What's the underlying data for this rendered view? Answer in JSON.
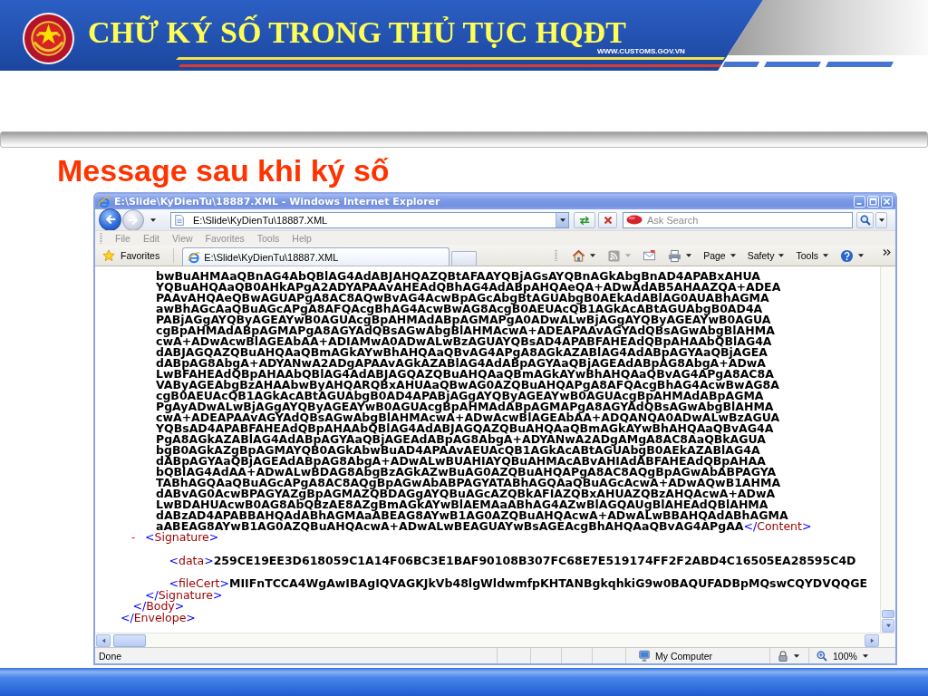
{
  "header": {
    "title": "CHỮ KÝ SỐ TRONG THỦ TỤC HQĐT",
    "website": "WWW.CUSTOMS.GOV.VN"
  },
  "heading": "Message sau khi ký số",
  "browser": {
    "title": "E:\\Slide\\KyDienTu\\18887.XML - Windows Internet Explorer",
    "navigation": [
      {
        "kind": "back",
        "disabled": false
      },
      {
        "kind": "forward",
        "disabled": true
      }
    ],
    "address": "E:\\Slide\\KyDienTu\\18887.XML",
    "search": {
      "placeholder": "Ask Search"
    },
    "menu": [
      "File",
      "Edit",
      "View",
      "Favorites",
      "Tools",
      "Help"
    ],
    "favorites": "Favorites",
    "tabs": [
      {
        "label": "E:\\Slide\\KyDienTu\\18887.XML",
        "selected": true
      }
    ],
    "commands": [
      {
        "kind": "home",
        "dropdown": true,
        "disabled": false
      },
      {
        "kind": "feeds",
        "dropdown": true,
        "disabled": true
      },
      {
        "kind": "mail",
        "dropdown": false,
        "disabled": false
      },
      {
        "kind": "print",
        "dropdown": true,
        "disabled": false
      },
      {
        "kind": "menu",
        "label": "Page",
        "dropdown": true,
        "disabled": false
      },
      {
        "kind": "menu",
        "label": "Safety",
        "dropdown": true,
        "disabled": false
      },
      {
        "kind": "menu",
        "label": "Tools",
        "dropdown": true,
        "disabled": false
      },
      {
        "kind": "help",
        "dropdown": true,
        "disabled": false
      }
    ],
    "document": {
      "kind": "element",
      "close_tag": "</Envelope>",
      "children": [
        {
          "kind": "element",
          "close_tag": "</Body>",
          "children": [
            {
              "kind": "text",
              "close_tag": "</Content>",
              "lines": [
                "bwBuAHMAaQBnAG4AbQBlAG4AdABJAHQAZQBtAFAAYQBjAGsAYQBnAGkAbgBnAD4APABxAHUA",
                "YQBuAHQAaQB0AHkAPgA2ADYAPAAvAHEAdQBhAG4AdABpAHQAeQA+ADwAdAB5AHAAZQA+ADEA",
                "PAAvAHQAeQBwAGUAPgA8AC8AQwBvAG4AcwBpAGcAbgBtAGUAbgB0AEkAdABlAG0AUABhAGMA",
                "awBhAGcAaQBuAGcAPgA8AFQAcgBhAG4AcwBwAG8AcgB0AEUAcQB1AGkAcABtAGUAbgB0AD4A",
                "PABjAGgAYQByAGEAYwB0AGUAcgBpAHMAdABpAGMAPgA0ADwALwBjAGgAYQByAGEAYwB0AGUA",
                "cgBpAHMAdABpAGMAPgA8AGYAdQBsAGwAbgBlAHMAcwA+ADEAPAAvAGYAdQBsAGwAbgBlAHMA",
                "cwA+ADwAcwBlAGEAbAA+ADIAMwA0ADwALwBzAGUAYQBsAD4APABFAHEAdQBpAHAAbQBlAG4A",
                "dABJAGQAZQBuAHQAaQBmAGkAYwBhAHQAaQBvAG4APgA8AGkAZABlAG4AdABpAGYAaQBjAGEA",
                "dABpAG8AbgA+ADYANwA2ADgAPAAvAGkAZABlAG4AdABpAGYAaQBjAGEAdABpAG8AbgA+ADwA",
                "LwBFAHEAdQBpAHAAbQBlAG4AdABJAGQAZQBuAHQAaQBmAGkAYwBhAHQAaQBvAG4APgA8AC8A",
                "VAByAGEAbgBzAHAAbwByAHQARQBxAHUAaQBwAG0AZQBuAHQAPgA8AFQAcgBhAG4AcwBwAG8A",
                "cgB0AEUAcQB1AGkAcABtAGUAbgB0AD4APABjAGgAYQByAGEAYwB0AGUAcgBpAHMAdABpAGMA",
                "PgAyADwALwBjAGgAYQByAGEAYwB0AGUAcgBpAHMAdABpAGMAPgA8AGYAdQBsAGwAbgBlAHMA",
                "cwA+ADEAPAAvAGYAdQBsAGwAbgBlAHMAcwA+ADwAcwBlAGEAbAA+ADQANQA0ADwALwBzAGUA",
                "YQBsAD4APABFAHEAdQBpAHAAbQBlAG4AdABJAGQAZQBuAHQAaQBmAGkAYwBhAHQAaQBvAG4A",
                "PgA8AGkAZABlAG4AdABpAGYAaQBjAGEAdABpAG8AbgA+ADYANwA2ADgAMgA8AC8AaQBkAGUA",
                "bgB0AGkAZgBpAGMAYQB0AGkAbwBuAD4APAAvAEUAcQB1AGkAcABtAGUAbgB0AEkAZABlAG4A",
                "dABpAGYAaQBjAGEAdABpAG8AbgA+ADwALwBUAHIAYQBuAHMAcABvAHIAdABFAHEAdQBpAHAA",
                "bQBlAG4AdAA+ADwALwBDAG8AbgBzAGkAZwBuAG0AZQBuAHQAPgA8AC8AQgBpAGwAbABPAGYA",
                "TABhAGQAaQBuAGcAPgA8AC8AQgBpAGwAbABPAGYATABhAGQAaQBuAGcAcwA+ADwAQwB1AHMA",
                "dABvAG0AcwBPAGYAZgBpAGMAZQBDAGgAYQBuAGcAZQBkAFIAZQBxAHUAZQBzAHQAcwA+ADwA",
                "LwBDAHUAcwB0AG8AbQBzAE8AZgBmAGkAYwBlAEMAaABhAG4AZwBlAGQAUgBlAHEAdQBlAHMA",
                "dABzAD4APABBAHQAdABhAGMAaABEAG8AYwB1AG0AZQBuAHQAcwA+ADwALwBBAHQAdABhAGMA",
                "aABEAG8AYwB1AG0AZQBuAHQAcwA+ADwALwBEAGUAYwBsAGEAcgBhAHQAaQBvAG4APgAA"
              ]
            },
            {
              "kind": "element",
              "toggle": "-",
              "open_tag": "<Signature>",
              "close_tag": "</Signature>",
              "children": [
                {
                  "kind": "leaf",
                  "open_tag": "<data>",
                  "value": "259CE19EE3D618059C1A14F06BC3E1BAF90108B307FC68E7E519174FF2F2ABD4C16505EA28595C4D"
                },
                {
                  "kind": "leaf",
                  "open_tag": "<fileCert>",
                  "value": "MIIFnTCCA4WgAwIBAgIQVAGKJkVb48lgWldwmfpKHTANBgkqhkiG9w0BAQUFADBpMQswCQYDVQQGE"
                }
              ]
            }
          ]
        }
      ]
    },
    "status": {
      "text": "Done",
      "zone": "My Computer",
      "zoom": "100%"
    }
  }
}
